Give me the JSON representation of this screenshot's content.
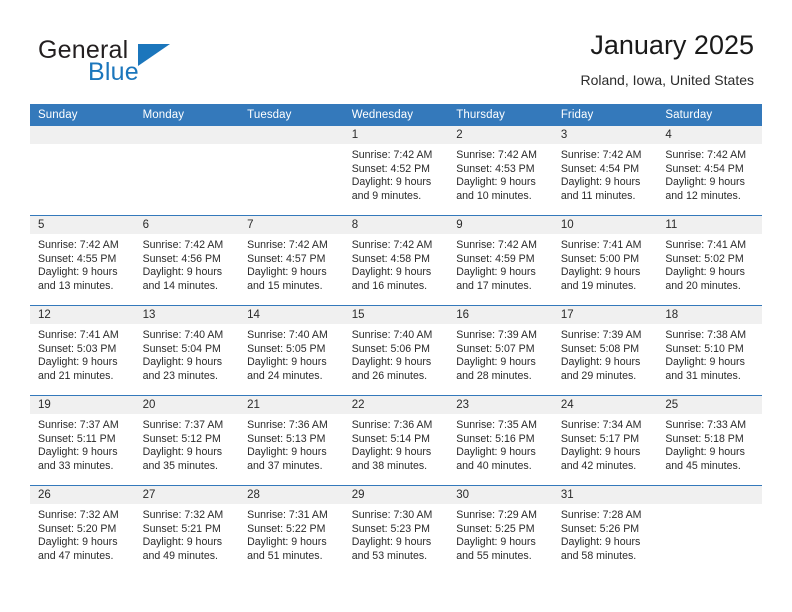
{
  "brand": {
    "word_one": "General",
    "word_two": "Blue",
    "logo_icon": "triangle-logo-icon",
    "accent_color": "#1b76bc"
  },
  "header": {
    "title": "January 2025",
    "subtitle": "Roland, Iowa, United States"
  },
  "calendar": {
    "header_bg_color": "#3479bb",
    "daynum_band_color": "#f0f0f0",
    "weekday_headers": [
      "Sunday",
      "Monday",
      "Tuesday",
      "Wednesday",
      "Thursday",
      "Friday",
      "Saturday"
    ],
    "weeks": [
      [
        {
          "day": "",
          "sunrise": "",
          "sunset": "",
          "daylight_line1": "",
          "daylight_line2": ""
        },
        {
          "day": "",
          "sunrise": "",
          "sunset": "",
          "daylight_line1": "",
          "daylight_line2": ""
        },
        {
          "day": "",
          "sunrise": "",
          "sunset": "",
          "daylight_line1": "",
          "daylight_line2": ""
        },
        {
          "day": "1",
          "sunrise": "Sunrise: 7:42 AM",
          "sunset": "Sunset: 4:52 PM",
          "daylight_line1": "Daylight: 9 hours",
          "daylight_line2": "and 9 minutes."
        },
        {
          "day": "2",
          "sunrise": "Sunrise: 7:42 AM",
          "sunset": "Sunset: 4:53 PM",
          "daylight_line1": "Daylight: 9 hours",
          "daylight_line2": "and 10 minutes."
        },
        {
          "day": "3",
          "sunrise": "Sunrise: 7:42 AM",
          "sunset": "Sunset: 4:54 PM",
          "daylight_line1": "Daylight: 9 hours",
          "daylight_line2": "and 11 minutes."
        },
        {
          "day": "4",
          "sunrise": "Sunrise: 7:42 AM",
          "sunset": "Sunset: 4:54 PM",
          "daylight_line1": "Daylight: 9 hours",
          "daylight_line2": "and 12 minutes."
        }
      ],
      [
        {
          "day": "5",
          "sunrise": "Sunrise: 7:42 AM",
          "sunset": "Sunset: 4:55 PM",
          "daylight_line1": "Daylight: 9 hours",
          "daylight_line2": "and 13 minutes."
        },
        {
          "day": "6",
          "sunrise": "Sunrise: 7:42 AM",
          "sunset": "Sunset: 4:56 PM",
          "daylight_line1": "Daylight: 9 hours",
          "daylight_line2": "and 14 minutes."
        },
        {
          "day": "7",
          "sunrise": "Sunrise: 7:42 AM",
          "sunset": "Sunset: 4:57 PM",
          "daylight_line1": "Daylight: 9 hours",
          "daylight_line2": "and 15 minutes."
        },
        {
          "day": "8",
          "sunrise": "Sunrise: 7:42 AM",
          "sunset": "Sunset: 4:58 PM",
          "daylight_line1": "Daylight: 9 hours",
          "daylight_line2": "and 16 minutes."
        },
        {
          "day": "9",
          "sunrise": "Sunrise: 7:42 AM",
          "sunset": "Sunset: 4:59 PM",
          "daylight_line1": "Daylight: 9 hours",
          "daylight_line2": "and 17 minutes."
        },
        {
          "day": "10",
          "sunrise": "Sunrise: 7:41 AM",
          "sunset": "Sunset: 5:00 PM",
          "daylight_line1": "Daylight: 9 hours",
          "daylight_line2": "and 19 minutes."
        },
        {
          "day": "11",
          "sunrise": "Sunrise: 7:41 AM",
          "sunset": "Sunset: 5:02 PM",
          "daylight_line1": "Daylight: 9 hours",
          "daylight_line2": "and 20 minutes."
        }
      ],
      [
        {
          "day": "12",
          "sunrise": "Sunrise: 7:41 AM",
          "sunset": "Sunset: 5:03 PM",
          "daylight_line1": "Daylight: 9 hours",
          "daylight_line2": "and 21 minutes."
        },
        {
          "day": "13",
          "sunrise": "Sunrise: 7:40 AM",
          "sunset": "Sunset: 5:04 PM",
          "daylight_line1": "Daylight: 9 hours",
          "daylight_line2": "and 23 minutes."
        },
        {
          "day": "14",
          "sunrise": "Sunrise: 7:40 AM",
          "sunset": "Sunset: 5:05 PM",
          "daylight_line1": "Daylight: 9 hours",
          "daylight_line2": "and 24 minutes."
        },
        {
          "day": "15",
          "sunrise": "Sunrise: 7:40 AM",
          "sunset": "Sunset: 5:06 PM",
          "daylight_line1": "Daylight: 9 hours",
          "daylight_line2": "and 26 minutes."
        },
        {
          "day": "16",
          "sunrise": "Sunrise: 7:39 AM",
          "sunset": "Sunset: 5:07 PM",
          "daylight_line1": "Daylight: 9 hours",
          "daylight_line2": "and 28 minutes."
        },
        {
          "day": "17",
          "sunrise": "Sunrise: 7:39 AM",
          "sunset": "Sunset: 5:08 PM",
          "daylight_line1": "Daylight: 9 hours",
          "daylight_line2": "and 29 minutes."
        },
        {
          "day": "18",
          "sunrise": "Sunrise: 7:38 AM",
          "sunset": "Sunset: 5:10 PM",
          "daylight_line1": "Daylight: 9 hours",
          "daylight_line2": "and 31 minutes."
        }
      ],
      [
        {
          "day": "19",
          "sunrise": "Sunrise: 7:37 AM",
          "sunset": "Sunset: 5:11 PM",
          "daylight_line1": "Daylight: 9 hours",
          "daylight_line2": "and 33 minutes."
        },
        {
          "day": "20",
          "sunrise": "Sunrise: 7:37 AM",
          "sunset": "Sunset: 5:12 PM",
          "daylight_line1": "Daylight: 9 hours",
          "daylight_line2": "and 35 minutes."
        },
        {
          "day": "21",
          "sunrise": "Sunrise: 7:36 AM",
          "sunset": "Sunset: 5:13 PM",
          "daylight_line1": "Daylight: 9 hours",
          "daylight_line2": "and 37 minutes."
        },
        {
          "day": "22",
          "sunrise": "Sunrise: 7:36 AM",
          "sunset": "Sunset: 5:14 PM",
          "daylight_line1": "Daylight: 9 hours",
          "daylight_line2": "and 38 minutes."
        },
        {
          "day": "23",
          "sunrise": "Sunrise: 7:35 AM",
          "sunset": "Sunset: 5:16 PM",
          "daylight_line1": "Daylight: 9 hours",
          "daylight_line2": "and 40 minutes."
        },
        {
          "day": "24",
          "sunrise": "Sunrise: 7:34 AM",
          "sunset": "Sunset: 5:17 PM",
          "daylight_line1": "Daylight: 9 hours",
          "daylight_line2": "and 42 minutes."
        },
        {
          "day": "25",
          "sunrise": "Sunrise: 7:33 AM",
          "sunset": "Sunset: 5:18 PM",
          "daylight_line1": "Daylight: 9 hours",
          "daylight_line2": "and 45 minutes."
        }
      ],
      [
        {
          "day": "26",
          "sunrise": "Sunrise: 7:32 AM",
          "sunset": "Sunset: 5:20 PM",
          "daylight_line1": "Daylight: 9 hours",
          "daylight_line2": "and 47 minutes."
        },
        {
          "day": "27",
          "sunrise": "Sunrise: 7:32 AM",
          "sunset": "Sunset: 5:21 PM",
          "daylight_line1": "Daylight: 9 hours",
          "daylight_line2": "and 49 minutes."
        },
        {
          "day": "28",
          "sunrise": "Sunrise: 7:31 AM",
          "sunset": "Sunset: 5:22 PM",
          "daylight_line1": "Daylight: 9 hours",
          "daylight_line2": "and 51 minutes."
        },
        {
          "day": "29",
          "sunrise": "Sunrise: 7:30 AM",
          "sunset": "Sunset: 5:23 PM",
          "daylight_line1": "Daylight: 9 hours",
          "daylight_line2": "and 53 minutes."
        },
        {
          "day": "30",
          "sunrise": "Sunrise: 7:29 AM",
          "sunset": "Sunset: 5:25 PM",
          "daylight_line1": "Daylight: 9 hours",
          "daylight_line2": "and 55 minutes."
        },
        {
          "day": "31",
          "sunrise": "Sunrise: 7:28 AM",
          "sunset": "Sunset: 5:26 PM",
          "daylight_line1": "Daylight: 9 hours",
          "daylight_line2": "and 58 minutes."
        },
        {
          "day": "",
          "sunrise": "",
          "sunset": "",
          "daylight_line1": "",
          "daylight_line2": ""
        }
      ]
    ]
  }
}
